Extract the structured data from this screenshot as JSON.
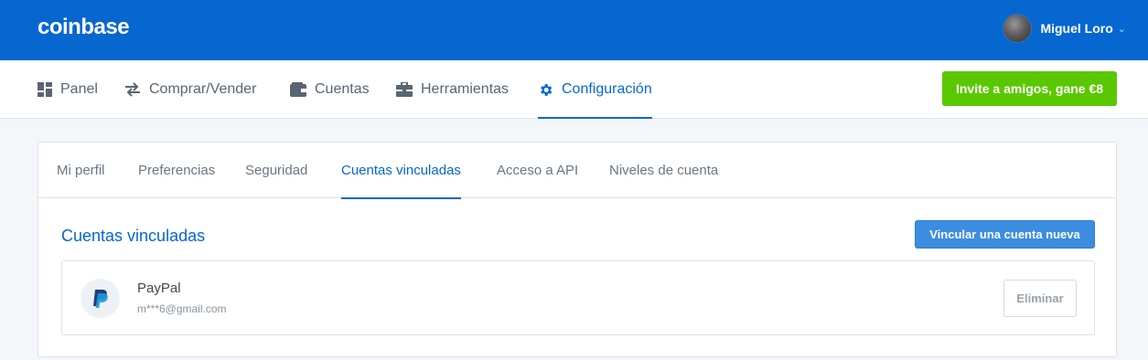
{
  "header": {
    "logo": "coinbase",
    "user_name": "Miguel Loro"
  },
  "nav": {
    "items": [
      {
        "label": "Panel",
        "icon": "dashboard-icon"
      },
      {
        "label": "Comprar/Vender",
        "icon": "exchange-arrows-icon"
      },
      {
        "label": "Cuentas",
        "icon": "wallet-icon"
      },
      {
        "label": "Herramientas",
        "icon": "toolbox-icon"
      },
      {
        "label": "Configuración",
        "icon": "gear-icon",
        "active": true
      }
    ],
    "invite_label": "Invite a amigos, gane €8"
  },
  "settings": {
    "tabs": [
      {
        "label": "Mi perfil"
      },
      {
        "label": "Preferencias"
      },
      {
        "label": "Seguridad"
      },
      {
        "label": "Cuentas vinculadas",
        "active": true
      },
      {
        "label": "Acceso a API"
      },
      {
        "label": "Niveles de cuenta"
      }
    ],
    "section_title": "Cuentas vinculadas",
    "link_button": "Vincular una cuenta nueva",
    "accounts": [
      {
        "name": "PayPal",
        "email": "m***6@gmail.com",
        "icon": "paypal-icon",
        "remove_label": "Eliminar"
      }
    ]
  },
  "colors": {
    "brand_blue": "#0667d0",
    "invite_green": "#5ac800",
    "button_blue": "#3c8de0"
  }
}
